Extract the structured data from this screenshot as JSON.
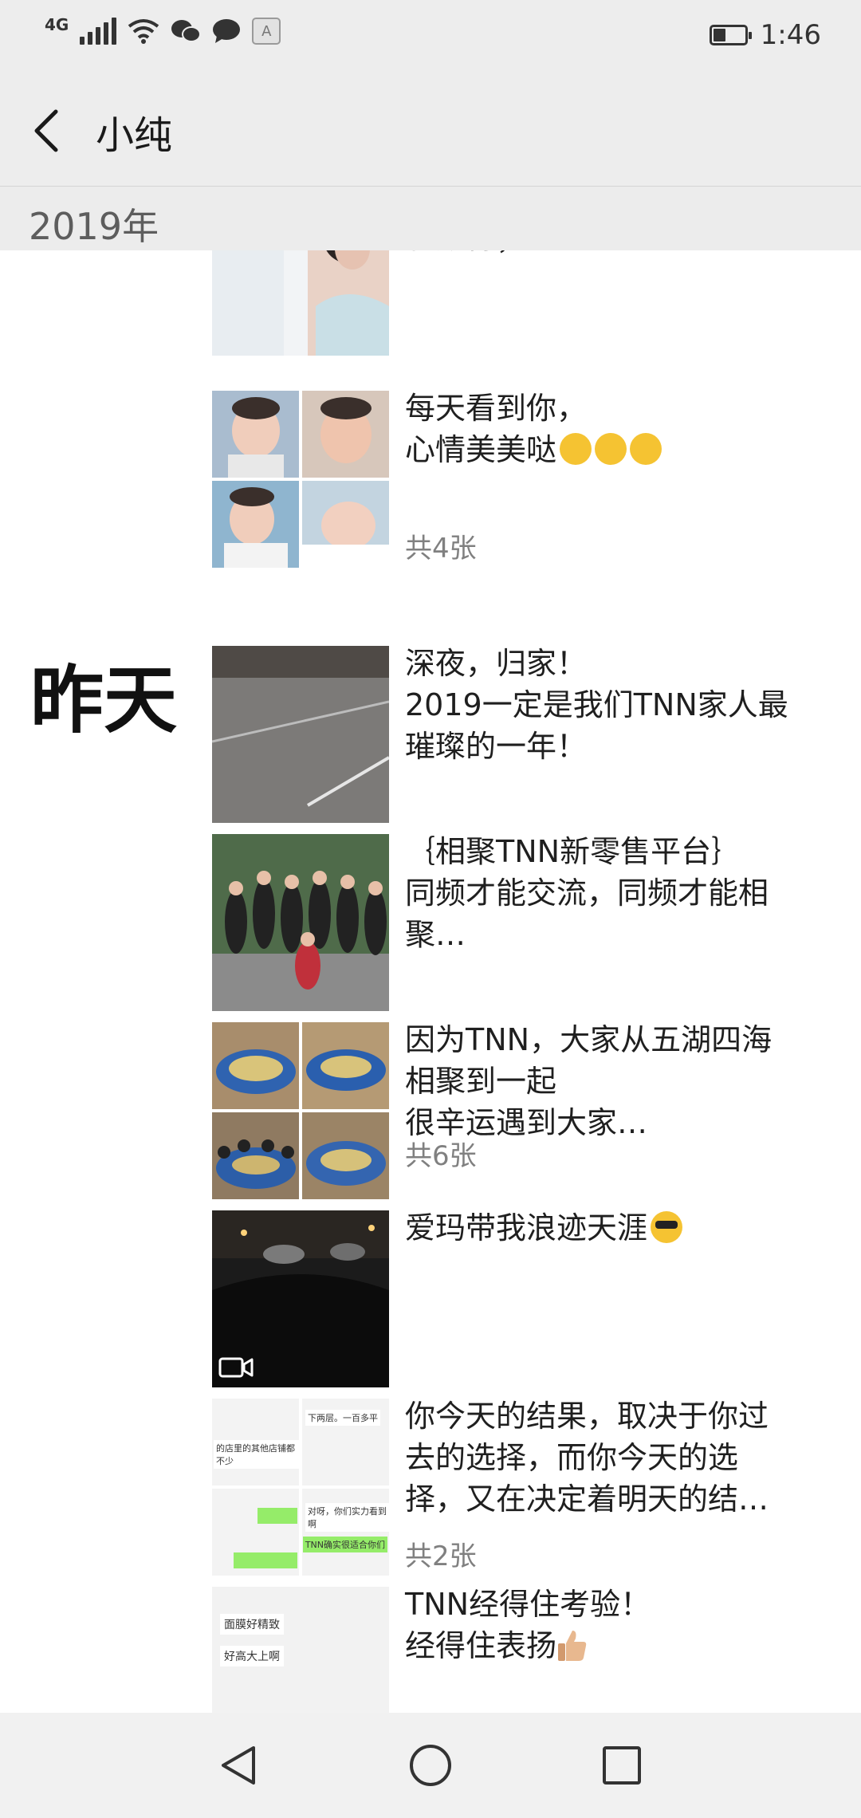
{
  "status_bar": {
    "network": "4G",
    "time": "1:46",
    "input_badge": "A",
    "battery_level": 0.4
  },
  "header": {
    "title": "小纯"
  },
  "year_label": "2019年",
  "day_labels": {
    "yesterday": "昨天"
  },
  "posts": [
    {
      "text": "总有一款面膜，配得上你所\n有期待；…"
    },
    {
      "text": "每天看到你，\n心情美美哒",
      "emoji": [
        "kiss-emoji",
        "kiss-emoji",
        "kiss-emoji"
      ],
      "count": "共4张"
    },
    {
      "text": "深夜，归家！\n2019一定是我们TNN家人最\n璀璨的一年！"
    },
    {
      "text": "｛相聚TNN新零售平台｝\n同频才能交流，同频才能相\n聚…"
    },
    {
      "text": "因为TNN，大家从五湖四海\n相聚到一起\n很辛运遇到大家…",
      "count": "共6张"
    },
    {
      "text": "爱玛带我浪迹天涯",
      "emoji": [
        "sunglasses-emoji"
      ],
      "video": true
    },
    {
      "text": "你今天的结果，取决于你过\n去的选择，而你今天的选\n择，又在决定着明天的结…",
      "count": "共2张"
    },
    {
      "text": "TNN经得住考验！\n经得住表扬",
      "emoji": [
        "thumbs-up-emoji"
      ]
    }
  ],
  "thumb_texts": {
    "p7": [
      "下两层。一百多平",
      "的店里的其他店铺都不少",
      "对呀，你们实力看到啊",
      "TNN确实很适合你们"
    ],
    "p8": [
      "面膜好精致",
      "好高大上啊"
    ]
  },
  "colors": {
    "bar_bg": "#ededed",
    "accent_green": "#95ec69",
    "text_gray": "#808080"
  }
}
